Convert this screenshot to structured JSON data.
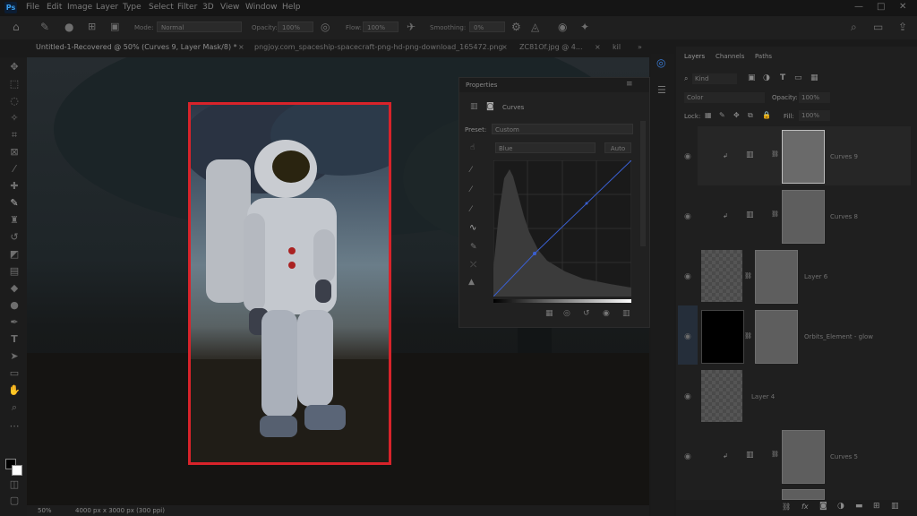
{
  "app": {
    "logo": "Ps"
  },
  "menu": [
    "File",
    "Edit",
    "Image",
    "Layer",
    "Type",
    "Select",
    "Filter",
    "3D",
    "View",
    "Window",
    "Help"
  ],
  "options_bar": {
    "mode_label": "Mode:",
    "mode_value": "Normal",
    "opacity_label": "Opacity:",
    "opacity_value": "100%",
    "flow_label": "Flow:",
    "flow_value": "100%",
    "smoothing_label": "Smoothing:",
    "smoothing_value": "0%"
  },
  "tabs": [
    {
      "label": "Untitled-1-Recovered @ 50% (Curves 9, Layer Mask/8) *",
      "close": "×"
    },
    {
      "label": "pngjoy.com_spaceship-spacecraft-png-hd-png-download_165472.png",
      "close": "×"
    },
    {
      "label": "ZC81Of.jpg @ 4...",
      "close": "×"
    },
    {
      "label": "kil",
      "close": ""
    }
  ],
  "tab_overflow": "»",
  "status": {
    "zoom": "50%",
    "doc_size": "4000 px x 3000 px (300 ppi)"
  },
  "properties": {
    "title": "Properties",
    "type_label": "Curves",
    "preset_label": "Preset:",
    "preset_value": "Custom",
    "channel_value": "Blue",
    "auto_label": "Auto"
  },
  "layers_panel": {
    "tabs": [
      "Layers",
      "Channels",
      "Paths"
    ],
    "filter_value": "Kind",
    "blend_mode": "Color",
    "opacity_label": "Opacity:",
    "opacity_value": "100%",
    "lock_label": "Lock:",
    "fill_label": "Fill:",
    "fill_value": "100%",
    "layers": [
      {
        "name": "Curves 9",
        "kind": "adjustment"
      },
      {
        "name": "Curves 8",
        "kind": "adjustment"
      },
      {
        "name": "Layer 6",
        "kind": "pixel"
      },
      {
        "name": "Orbits_Element - glow",
        "kind": "pixel"
      },
      {
        "name": "Layer 4",
        "kind": "pixel"
      },
      {
        "name": "Curves 5",
        "kind": "adjustment"
      }
    ],
    "fx_label": "fx"
  },
  "colors": {
    "selection_outline": "#d8232a",
    "accent": "#3aa0f0",
    "curve_line": "#3a5fd0"
  }
}
